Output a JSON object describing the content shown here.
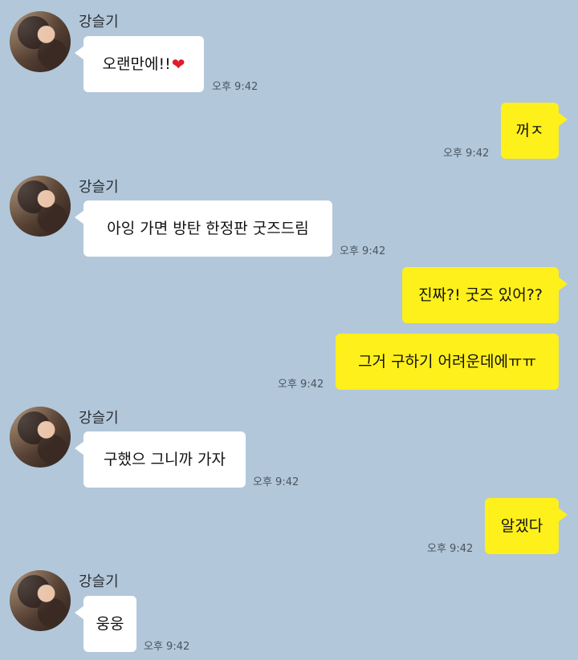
{
  "contact": {
    "name": "강슬기"
  },
  "messages": [
    {
      "from": "contact",
      "text": "오랜만에!!",
      "time": "오후 9:42",
      "icon": "heart-icon"
    },
    {
      "from": "me",
      "text": "꺼ㅈ",
      "time": "오후 9:42"
    },
    {
      "from": "contact",
      "text": "아잉 가면 방탄 한정판 굿즈드림",
      "time": "오후 9:42"
    },
    {
      "from": "me",
      "text": "진짜?! 굿즈 있어??",
      "time": ""
    },
    {
      "from": "me",
      "text": "그거 구하기 어려운데에ㅠㅠ",
      "time": "오후 9:42"
    },
    {
      "from": "contact",
      "text": "구했으 그니까 가자",
      "time": "오후 9:42"
    },
    {
      "from": "me",
      "text": "알겠다",
      "time": "오후 9:42"
    },
    {
      "from": "contact",
      "text": "웅웅",
      "time": "오후 9:42"
    }
  ],
  "colors": {
    "background": "#b2c7da",
    "incoming": "#ffffff",
    "outgoing": "#fef01b",
    "heart": "#e11b2b"
  }
}
